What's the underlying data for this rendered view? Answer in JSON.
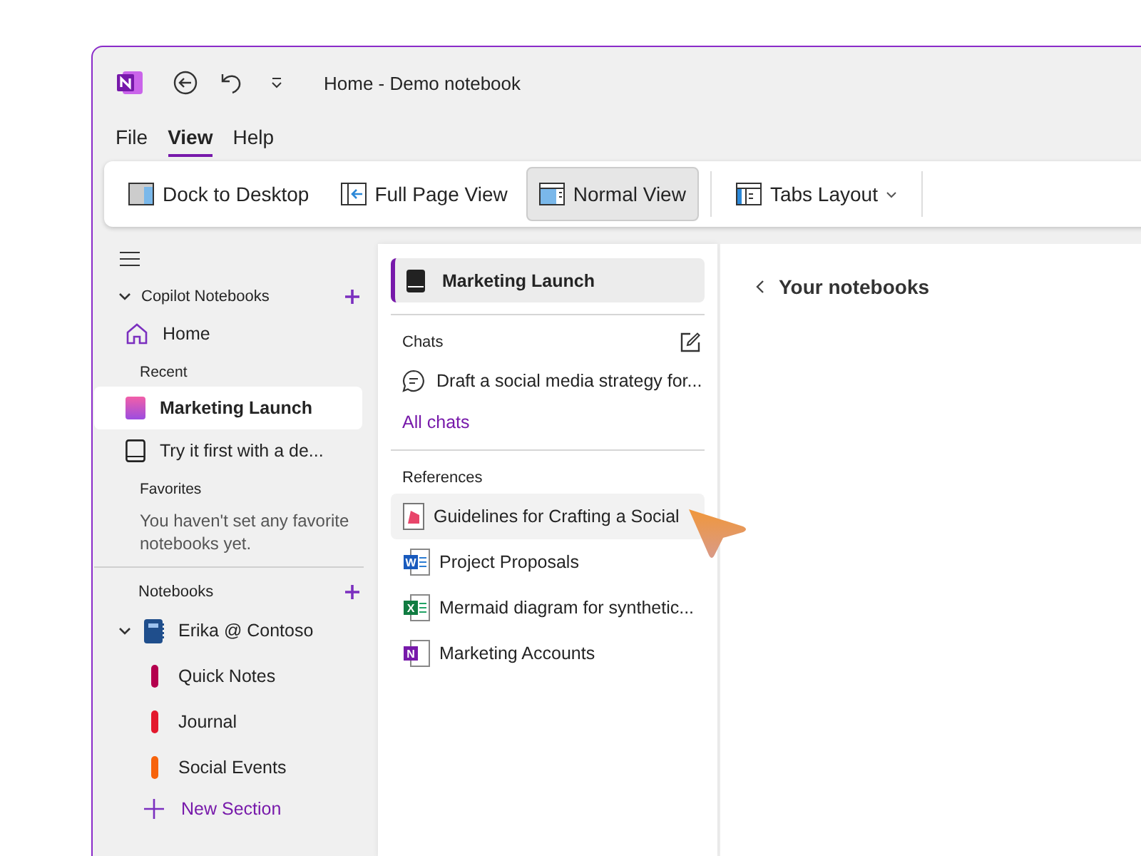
{
  "window": {
    "title": "Home - Demo notebook"
  },
  "menu": [
    {
      "label": "File",
      "selected": false
    },
    {
      "label": "View",
      "selected": true
    },
    {
      "label": "Help",
      "selected": false
    }
  ],
  "ribbon": [
    {
      "label": "Dock to Desktop",
      "kind": "dock",
      "selected": false,
      "dropdown": false
    },
    {
      "label": "Full Page View",
      "kind": "fullpage",
      "selected": false,
      "dropdown": false
    },
    {
      "label": "Normal View",
      "kind": "normal",
      "selected": true,
      "dropdown": false
    },
    {
      "label": "Tabs Layout",
      "kind": "tabs",
      "selected": false,
      "dropdown": true
    }
  ],
  "sidebar": {
    "copilot_heading": "Copilot Notebooks",
    "home": "Home",
    "recent_heading": "Recent",
    "recent": [
      {
        "label": "Marketing Launch",
        "kind": "color",
        "selected": true
      },
      {
        "label": "Try it first with a de...",
        "kind": "plain",
        "selected": false
      }
    ],
    "favorites_heading": "Favorites",
    "favorites_empty": "You haven't set any favorite notebooks yet.",
    "notebooks_heading": "Notebooks",
    "notebooks": [
      {
        "label": "Erika @ Contoso",
        "expanded": true,
        "sections": [
          {
            "label": "Quick Notes",
            "color": "#b4004e"
          },
          {
            "label": "Journal",
            "color": "#e3182d"
          },
          {
            "label": "Social Events",
            "color": "#f7630c"
          }
        ]
      }
    ],
    "new_section": "New Section"
  },
  "notebook_panel": {
    "title": "Marketing Launch",
    "chats_heading": "Chats",
    "chats": [
      "Draft a social media strategy for..."
    ],
    "all_chats": "All chats",
    "references_heading": "References",
    "references": [
      {
        "label": "Guidelines for Crafting a Social",
        "kind": "page",
        "selected": true
      },
      {
        "label": "Project Proposals",
        "kind": "word",
        "badge": "W",
        "selected": false
      },
      {
        "label": "Mermaid diagram for synthetic...",
        "kind": "excel",
        "badge": "X",
        "selected": false
      },
      {
        "label": "Marketing Accounts",
        "kind": "onenote",
        "badge": "N",
        "selected": false
      }
    ]
  },
  "content": {
    "back_link": "Your notebooks"
  }
}
